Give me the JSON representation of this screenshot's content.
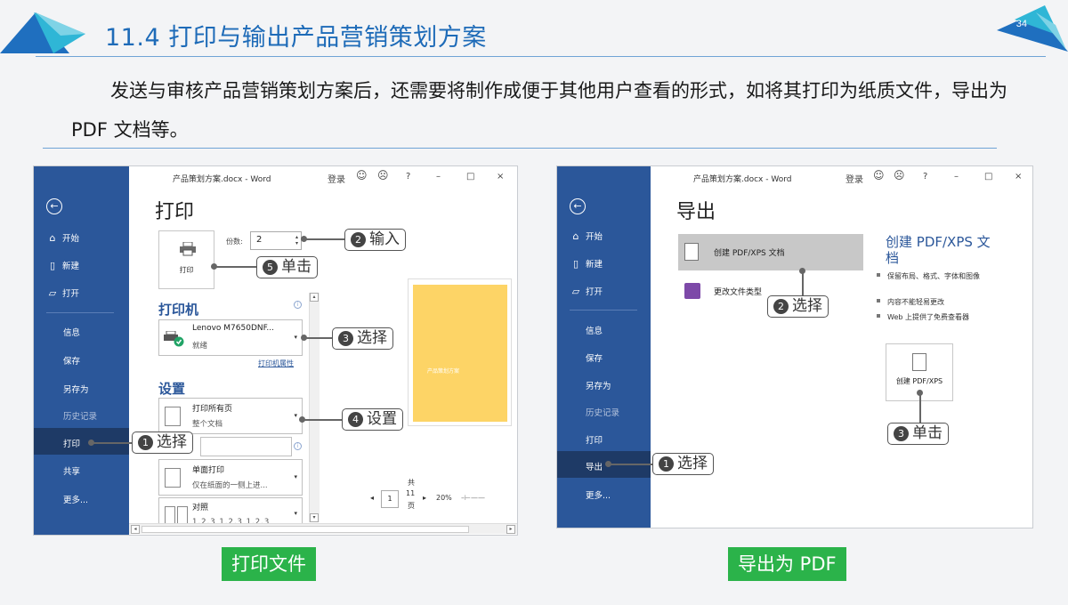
{
  "slide": {
    "title": "11.4 打印与输出产品营销策划方案",
    "page_number": "34",
    "intro": "发送与审核产品营销策划方案后，还需要将制作成便于其他用户查看的形式，如将其打印为纸质文件，导出为 PDF 文档等。",
    "accent_color": "#1e6bb8",
    "caption_color": "#2bb34a"
  },
  "print_window": {
    "titlebar": "产品策划方案.docx - Word",
    "login": "登录",
    "controls": [
      "☺",
      "☹",
      "?",
      "–",
      "□",
      "×"
    ],
    "heading": "打印",
    "print_button_label": "打印",
    "copies_label": "份数:",
    "copies_value": "2",
    "printer_section": "打印机",
    "printer_name": "Lenovo M7650DNF...",
    "printer_status": "就绪",
    "printer_properties": "打印机属性",
    "settings_section": "设置",
    "setting1_title": "打印所有页",
    "setting1_sub": "整个文档",
    "setting3_title": "单面打印",
    "setting3_sub": "仅在纸面的一侧上进...",
    "setting4_title": "对照",
    "setting4_sub": "1,2,3   1,2,3   1,2,3",
    "preview_title": "产品策划方案",
    "page_current": "1",
    "page_total_prefix": "共",
    "page_total": "11",
    "page_total_suffix": "页",
    "zoom": "20%",
    "sidebar": {
      "back": "←",
      "items": [
        "开始",
        "新建",
        "打开"
      ],
      "items2": [
        "信息",
        "保存",
        "另存为",
        "历史记录",
        "打印",
        "共享",
        "更多..."
      ]
    },
    "callouts": {
      "c1": {
        "num": "1",
        "text": "选择"
      },
      "c2": {
        "num": "2",
        "text": "输入"
      },
      "c3": {
        "num": "3",
        "text": "选择"
      },
      "c4": {
        "num": "4",
        "text": "设置"
      },
      "c5": {
        "num": "5",
        "text": "单击"
      }
    },
    "caption": "打印文件"
  },
  "export_window": {
    "titlebar": "产品策划方案.docx - Word",
    "login": "登录",
    "controls": [
      "☺",
      "☹",
      "?",
      "–",
      "□",
      "×"
    ],
    "heading": "导出",
    "item1": "创建 PDF/XPS 文档",
    "item2": "更改文件类型",
    "panel_title": "创建 PDF/XPS 文档",
    "bullets": [
      "保留布局、格式、字体和图像",
      "内容不能轻易更改",
      "Web 上提供了免费查看器"
    ],
    "create_button": "创建 PDF/XPS",
    "sidebar": {
      "back": "←",
      "items": [
        "开始",
        "新建",
        "打开"
      ],
      "items2": [
        "信息",
        "保存",
        "另存为",
        "历史记录",
        "打印",
        "导出",
        "更多..."
      ]
    },
    "callouts": {
      "c1": {
        "num": "1",
        "text": "选择"
      },
      "c2": {
        "num": "2",
        "text": "选择"
      },
      "c3": {
        "num": "3",
        "text": "单击"
      }
    },
    "caption": "导出为 PDF"
  }
}
